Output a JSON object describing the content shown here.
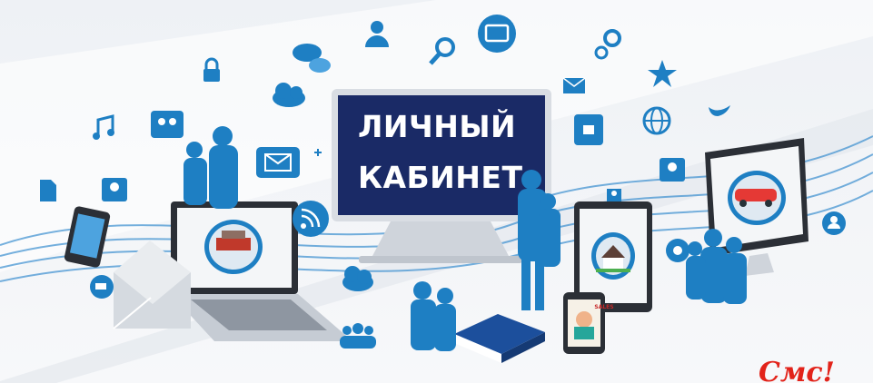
{
  "monitor": {
    "line1": "ЛИЧНЫЙ",
    "line2": "КАБИНЕТ"
  },
  "phone_screen_label": "SALES",
  "corner_text": "Смс!",
  "colors": {
    "accent": "#1e7fc3",
    "screen": "#1a2a66",
    "red": "#e2231a",
    "background": "#f1f3f6"
  },
  "icons": [
    "lock-icon",
    "chat-icon",
    "user-icon",
    "search-icon",
    "tablet-icon",
    "gears-icon",
    "music-icon",
    "group-icon",
    "cloud-icon",
    "mail-icon",
    "plus-icon",
    "star-icon",
    "twitter-icon",
    "globe-icon",
    "contact-icon",
    "document-icon",
    "rss-icon",
    "cart-icon",
    "camera-icon",
    "settings-cloud-icon",
    "people-icon"
  ]
}
